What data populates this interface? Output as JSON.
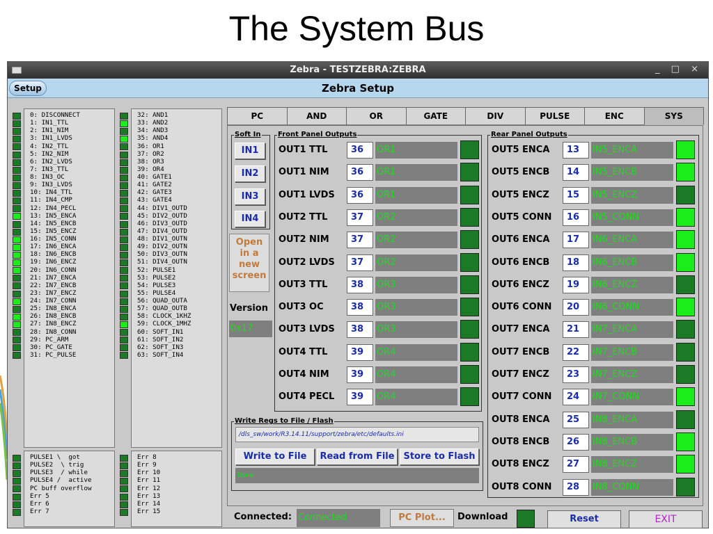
{
  "slide_title": "The System Bus",
  "window": {
    "title": "Zebra - TESTZEBRA:ZEBRA",
    "controls": "_ □ ×"
  },
  "setup": {
    "button_label": "Setup",
    "title": "Zebra Setup"
  },
  "sig_list_a": "0: DISCONNECT\n1: IN1_TTL\n2: IN1_NIM\n3: IN1_LVDS\n4: IN2_TTL\n5: IN2_NIM\n6: IN2_LVDS\n7: IN3_TTL\n8: IN3_OC\n9: IN3_LVDS\n10: IN4_TTL\n11: IN4_CMP\n12: IN4_PECL\n13: IN5_ENCA\n14: IN5_ENCB\n15: IN5_ENCZ\n16: IN5_CONN\n17: IN6_ENCA\n18: IN6_ENCB\n19: IN6_ENCZ\n20: IN6_CONN\n21: IN7_ENCA\n22: IN7_ENCB\n23: IN7_ENCZ\n24: IN7_CONN\n25: IN8_ENCA\n26: IN8_ENCB\n27: IN8_ENCZ\n28: IN8_CONN\n29: PC_ARM\n30: PC_GATE\n31: PC_PULSE",
  "sig_list_b": "32: AND1\n33: AND2\n34: AND3\n35: AND4\n36: OR1\n37: OR2\n38: OR3\n39: OR4\n40: GATE1\n41: GATE2\n42: GATE3\n43: GATE4\n44: DIV1_OUTD\n45: DIV2_OUTD\n46: DIV3_OUTD\n47: DIV4_OUTD\n48: DIV1_OUTN\n49: DIV2_OUTN\n50: DIV3_OUTN\n51: DIV4_OUTN\n52: PULSE1\n53: PULSE2\n54: PULSE3\n55: PULSE4\n56: QUAD_OUTA\n57: QUAD_OUTB\n58: CLOCK_1KHZ\n59: CLOCK_1MHZ\n60: SOFT_IN1\n61: SOFT_IN2\n62: SOFT_IN3\n63: SOFT_IN4",
  "status_list_a": "PULSE1 \\  got\nPULSE2  \\ trig\nPULSE3  / while\nPULSE4 /  active\nPC buff overflow\nErr 5\nErr 6\nErr 7",
  "status_list_b": "Err 8\nErr 9\nErr 10\nErr 11\nErr 12\nErr 13\nErr 14\nErr 15",
  "leds_a": [
    0,
    0,
    0,
    0,
    0,
    0,
    0,
    0,
    0,
    0,
    0,
    0,
    0,
    1,
    0,
    0,
    1,
    1,
    1,
    1,
    1,
    0,
    0,
    0,
    1,
    0,
    1,
    1,
    0,
    0,
    0,
    0
  ],
  "leds_b": [
    0,
    1,
    0,
    1,
    0,
    0,
    0,
    0,
    0,
    0,
    0,
    0,
    0,
    0,
    0,
    0,
    0,
    0,
    0,
    0,
    0,
    0,
    0,
    0,
    0,
    0,
    0,
    1,
    0,
    0,
    0,
    0
  ],
  "leds_status_a": [
    0,
    0,
    0,
    0,
    0,
    0,
    0,
    0
  ],
  "leds_status_b": [
    0,
    0,
    0,
    0,
    0,
    0,
    0,
    0
  ],
  "tabs": [
    "PC",
    "AND",
    "OR",
    "GATE",
    "DIV",
    "PULSE",
    "ENC",
    "SYS"
  ],
  "active_tab": "SYS",
  "soft_in": {
    "title": "Soft In",
    "buttons": [
      "IN1",
      "IN2",
      "IN3",
      "IN4"
    ]
  },
  "open_new_screen": "Open in a new screen",
  "version": {
    "label": "Version",
    "value": "0x17"
  },
  "front_panel": {
    "title": "Front Panel Outputs",
    "rows": [
      {
        "label": "OUT1 TTL",
        "num": "36",
        "name": "OR1",
        "state": 0
      },
      {
        "label": "OUT1 NIM",
        "num": "36",
        "name": "OR1",
        "state": 0
      },
      {
        "label": "OUT1 LVDS",
        "num": "36",
        "name": "OR1",
        "state": 0
      },
      {
        "label": "OUT2 TTL",
        "num": "37",
        "name": "OR2",
        "state": 0
      },
      {
        "label": "OUT2 NIM",
        "num": "37",
        "name": "OR2",
        "state": 0
      },
      {
        "label": "OUT2 LVDS",
        "num": "37",
        "name": "OR2",
        "state": 0
      },
      {
        "label": "OUT3 TTL",
        "num": "38",
        "name": "OR3",
        "state": 0
      },
      {
        "label": "OUT3 OC",
        "num": "38",
        "name": "OR3",
        "state": 0
      },
      {
        "label": "OUT3 LVDS",
        "num": "38",
        "name": "OR3",
        "state": 0
      },
      {
        "label": "OUT4 TTL",
        "num": "39",
        "name": "OR4",
        "state": 0
      },
      {
        "label": "OUT4 NIM",
        "num": "39",
        "name": "OR4",
        "state": 0
      },
      {
        "label": "OUT4 PECL",
        "num": "39",
        "name": "OR4",
        "state": 0
      }
    ]
  },
  "rear_panel": {
    "title": "Rear Panel Outputs",
    "rows": [
      {
        "label": "OUT5 ENCA",
        "num": "13",
        "name": "IN5_ENCA",
        "state": 1
      },
      {
        "label": "OUT5 ENCB",
        "num": "14",
        "name": "IN5_ENCB",
        "state": 1
      },
      {
        "label": "OUT5 ENCZ",
        "num": "15",
        "name": "IN5_ENCZ",
        "state": 0
      },
      {
        "label": "OUT5 CONN",
        "num": "16",
        "name": "IN5_CONN",
        "state": 1
      },
      {
        "label": "OUT6 ENCA",
        "num": "17",
        "name": "IN6_ENCA",
        "state": 1
      },
      {
        "label": "OUT6 ENCB",
        "num": "18",
        "name": "IN6_ENCB",
        "state": 1
      },
      {
        "label": "OUT6 ENCZ",
        "num": "19",
        "name": "IN6_ENCZ",
        "state": 0
      },
      {
        "label": "OUT6 CONN",
        "num": "20",
        "name": "IN6_CONN",
        "state": 1
      },
      {
        "label": "OUT7 ENCA",
        "num": "21",
        "name": "IN7_ENCA",
        "state": 0
      },
      {
        "label": "OUT7 ENCB",
        "num": "22",
        "name": "IN7_ENCB",
        "state": 0
      },
      {
        "label": "OUT7 ENCZ",
        "num": "23",
        "name": "IN7_ENCZ",
        "state": 0
      },
      {
        "label": "OUT7 CONN",
        "num": "24",
        "name": "IN7_CONN",
        "state": 1
      },
      {
        "label": "OUT8 ENCA",
        "num": "25",
        "name": "IN8_ENCA",
        "state": 0
      },
      {
        "label": "OUT8 ENCB",
        "num": "26",
        "name": "IN8_ENCB",
        "state": 1
      },
      {
        "label": "OUT8 ENCZ",
        "num": "27",
        "name": "IN8_ENCZ",
        "state": 1
      },
      {
        "label": "OUT8 CONN",
        "num": "28",
        "name": "IN8_CONN",
        "state": 0
      }
    ]
  },
  "write_regs": {
    "title": "Write Regs to File / Flash",
    "path": "/dls_sw/work/R3.14.11/support/zebra/etc/defaults.ini",
    "write_label": "Write to File",
    "read_label": "Read from File",
    "store_label": "Store to Flash",
    "status": "Done"
  },
  "bottom": {
    "connected_label": "Connected:",
    "connected_value": "Connected",
    "pc_plot": "PC Plot...",
    "download_label": "Download",
    "reset": "Reset",
    "exit": "EXIT"
  },
  "colors": {
    "led_on": "#1bed1b",
    "led_off": "#1b7a26",
    "label_blue": "#1a2ca8",
    "value_green": "#1fdc1f",
    "exit_magenta": "#b222c8"
  }
}
